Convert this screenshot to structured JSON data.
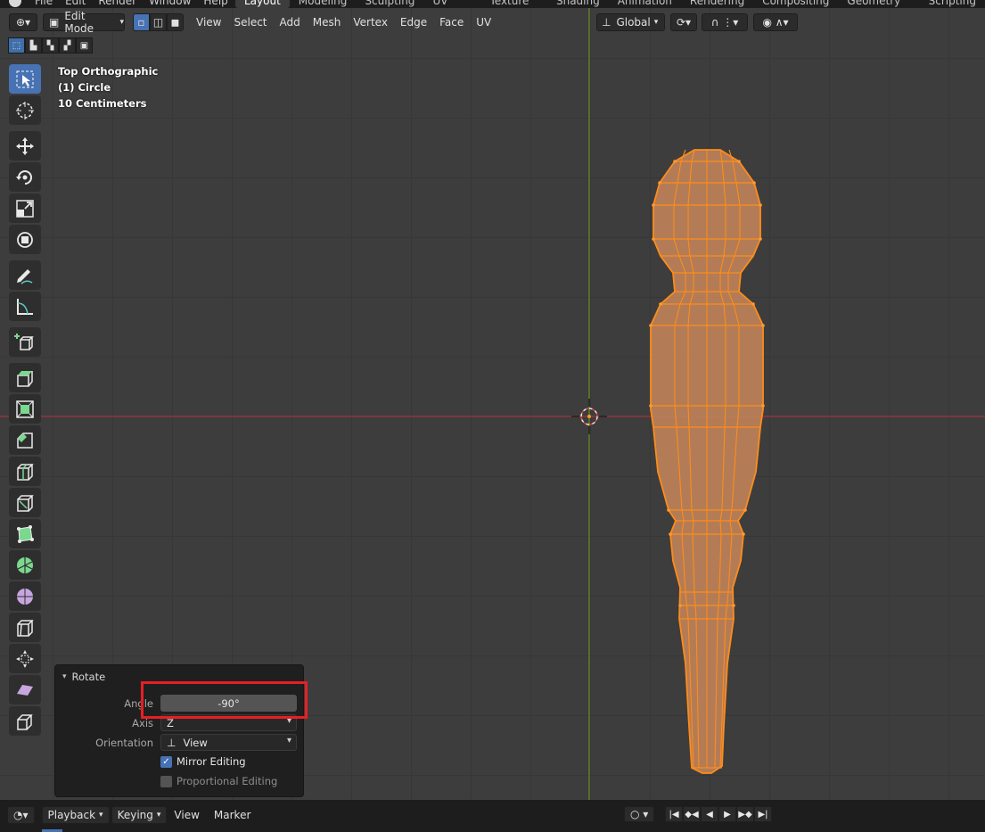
{
  "menubar": {
    "items": [
      "File",
      "Edit",
      "Render",
      "Window",
      "Help"
    ],
    "workspaces": [
      "Layout",
      "Modeling",
      "Sculpting",
      "UV Editing",
      "Texture Paint",
      "Shading",
      "Animation",
      "Rendering",
      "Compositing",
      "Geometry Nodes",
      "Scripting"
    ],
    "active_workspace": "Layout"
  },
  "header": {
    "mode": "Edit Mode",
    "menus": [
      "View",
      "Select",
      "Add",
      "Mesh",
      "Vertex",
      "Edge",
      "Face",
      "UV"
    ],
    "orientation": "Global"
  },
  "overlay": {
    "view_name": "Top Orthographic",
    "object": "(1) Circle",
    "scale": "10 Centimeters"
  },
  "toolbar": {
    "icons": [
      "select-box-icon",
      "cursor-icon",
      "move-icon",
      "rotate-icon",
      "scale-icon",
      "transform-icon",
      "annotate-icon",
      "measure-icon",
      "add-cube-icon",
      "extrude-region-icon",
      "inset-faces-icon",
      "bevel-icon",
      "loop-cut-icon",
      "knife-icon",
      "poly-build-icon",
      "spin-icon",
      "smooth-icon",
      "edge-slide-icon",
      "shrink-fatten-icon",
      "shear-icon",
      "rip-region-icon"
    ]
  },
  "panel": {
    "title": "Rotate",
    "angle_label": "Angle",
    "angle_value": "-90°",
    "axis_label": "Axis",
    "axis_value": "Z",
    "orientation_label": "Orientation",
    "orientation_value": "View",
    "mirror_label": "Mirror Editing",
    "mirror_checked": true,
    "proportional_label": "Proportional Editing",
    "proportional_checked": false
  },
  "timeline": {
    "playback": "Playback",
    "keying": "Keying",
    "view": "View",
    "marker": "Marker"
  },
  "colors": {
    "mesh_fill": "#e8a05a",
    "mesh_edge": "#ff8c1a",
    "x_axis": "#a3343f",
    "y_axis": "#6b8e23",
    "accent": "#4772b3",
    "highlight": "#e81e25"
  }
}
